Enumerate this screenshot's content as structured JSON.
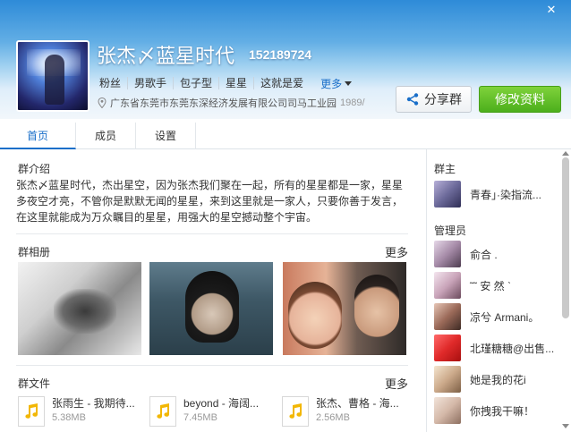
{
  "header": {
    "group_name": "张杰〆蓝星时代",
    "group_id": "152189724",
    "tags": [
      "粉丝",
      "男歌手",
      "包子型",
      "星星",
      "这就是爱"
    ],
    "more_label": "更多",
    "location": "广东省东莞市东莞东深经济发展有限公司司马工业园",
    "location_extra": "1989/",
    "share_label": "分享群",
    "edit_label": "修改资料",
    "close_glyph": "✕",
    "colors": {
      "edit_button": "#5cbf26",
      "accent": "#1a6fc9"
    }
  },
  "tabs": [
    {
      "label": "首页",
      "active": true
    },
    {
      "label": "成员",
      "active": false
    },
    {
      "label": "设置",
      "active": false
    }
  ],
  "intro": {
    "title": "群介绍",
    "text": "张杰〆蓝星时代，杰出星空，因为张杰我们聚在一起，所有的星星都是一家，星星多夜空才亮，不管你是默默无闻的星星，来到这里就是一家人，只要你善于发言，在这里就能成为万众瞩目的星星，用强大的星空撼动整个宇宙。"
  },
  "album": {
    "title": "群相册",
    "more_label": "更多"
  },
  "files": {
    "title": "群文件",
    "more_label": "更多",
    "items": [
      {
        "name": "张雨生 - 我期待...",
        "size": "5.38MB",
        "icon": "music-file-icon"
      },
      {
        "name": "beyond - 海阔...",
        "size": "7.45MB",
        "icon": "music-file-icon"
      },
      {
        "name": "张杰、曹格 - 海...",
        "size": "2.56MB",
        "icon": "music-file-icon"
      }
    ]
  },
  "sidebar": {
    "owner_title": "群主",
    "owner": {
      "name": "青春」·染指流..."
    },
    "admin_title": "管理员",
    "admins": [
      {
        "name": "俞合 ."
      },
      {
        "name": "˜˜ 安 然 ˋ"
      },
      {
        "name": " 凉兮 Armani。"
      },
      {
        "name": "北瑾糖糖@出售..."
      },
      {
        "name": "她是我的花i"
      },
      {
        "name": "你拽我干嘛！"
      }
    ]
  }
}
